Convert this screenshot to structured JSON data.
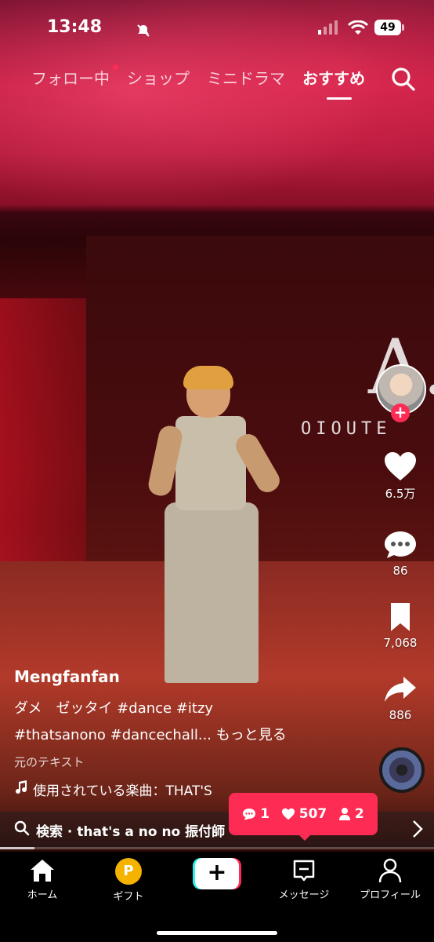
{
  "status_bar": {
    "time": "13:48",
    "battery": "49"
  },
  "top_tabs": [
    {
      "label": "フォロー中"
    },
    {
      "label": "ショップ"
    },
    {
      "label": "ミニドラマ"
    },
    {
      "label": "おすすめ"
    }
  ],
  "video": {
    "backdrop_logo_letter": "A.",
    "backdrop_logo_text": "OIOUTE"
  },
  "actions": {
    "likes": "6.5万",
    "comments": "86",
    "saves": "7,068",
    "shares": "886"
  },
  "caption": {
    "username": "Mengfanfan",
    "line1": "ダメ　ゼッタイ #dance #itzy",
    "line2": "#thatsanono #dancechall...",
    "more": "もっと見る",
    "original_text": "元のテキスト",
    "music": "使用されている楽曲：THAT'S"
  },
  "search_bar": {
    "label": "検索 · that's a no no 振付師"
  },
  "progress_fraction": 0.08,
  "notification": {
    "comments": "1",
    "likes": "507",
    "followers": "2"
  },
  "bottom_nav": {
    "home": "ホーム",
    "gift": "ギフト",
    "gift_coin": "P",
    "create": "+",
    "messages": "メッセージ",
    "profile": "プロフィール"
  },
  "colors": {
    "accent": "#fe2c55",
    "cyan": "#25f4ee"
  }
}
